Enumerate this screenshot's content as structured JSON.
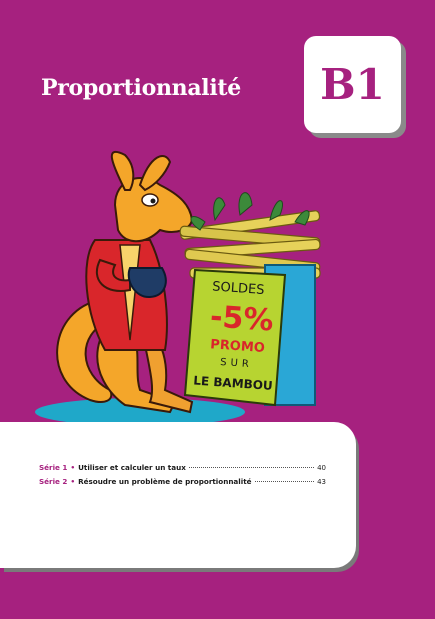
{
  "header": {
    "title": "Proportionnalité",
    "badge": "B1"
  },
  "illustration": {
    "sign_line1": "SOLDES",
    "sign_line2": "-5%",
    "sign_line3": "PROMO",
    "sign_line4": "SUR",
    "sign_line5": "LE BAMBOU"
  },
  "toc": [
    {
      "serie": "Série 1",
      "bullet": "•",
      "label": "Utiliser et calculer un taux",
      "page": "40"
    },
    {
      "serie": "Série 2",
      "bullet": "•",
      "label": "Résoudre un problème de proportionnalité",
      "page": "43"
    }
  ],
  "colors": {
    "background": "#a6217f",
    "accent": "#a6217f",
    "panel": "#ffffff"
  }
}
